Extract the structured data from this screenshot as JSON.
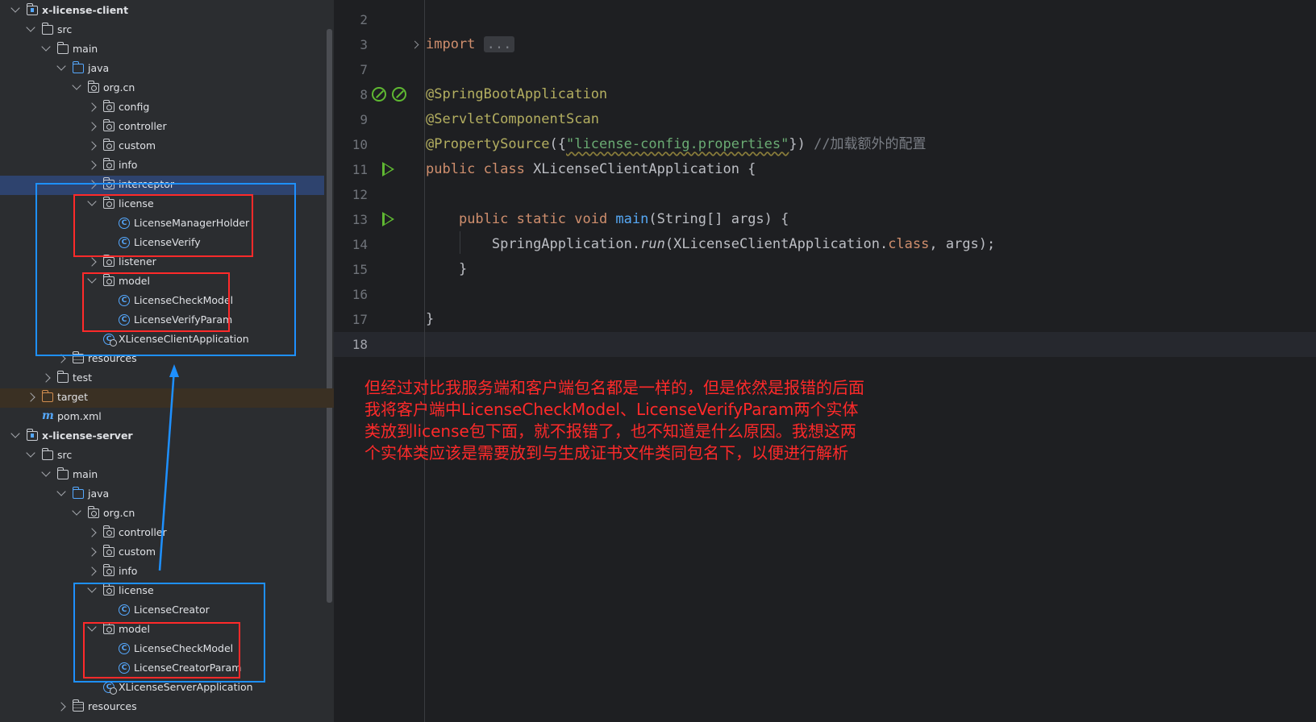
{
  "tree": [
    {
      "label": "x-license-client",
      "icon": "module",
      "expanded": true,
      "bold": true,
      "depth": 0
    },
    {
      "label": "src",
      "icon": "folder",
      "expanded": true,
      "depth": 1
    },
    {
      "label": "main",
      "icon": "folder",
      "expanded": true,
      "depth": 2
    },
    {
      "label": "java",
      "icon": "source-folder",
      "expanded": true,
      "depth": 3
    },
    {
      "label": "org.cn",
      "icon": "package",
      "expanded": true,
      "depth": 4
    },
    {
      "label": "config",
      "icon": "package",
      "expanded": false,
      "depth": 5
    },
    {
      "label": "controller",
      "icon": "package",
      "expanded": false,
      "depth": 5
    },
    {
      "label": "custom",
      "icon": "package",
      "expanded": false,
      "depth": 5
    },
    {
      "label": "info",
      "icon": "package",
      "expanded": false,
      "depth": 5
    },
    {
      "label": "interceptor",
      "icon": "package",
      "expanded": false,
      "depth": 5,
      "selected": true
    },
    {
      "label": "license",
      "icon": "package",
      "expanded": true,
      "depth": 5
    },
    {
      "label": "LicenseManagerHolder",
      "icon": "class",
      "depth": 6
    },
    {
      "label": "LicenseVerify",
      "icon": "class",
      "depth": 6
    },
    {
      "label": "listener",
      "icon": "package",
      "expanded": false,
      "depth": 5
    },
    {
      "label": "model",
      "icon": "package",
      "expanded": true,
      "depth": 5
    },
    {
      "label": "LicenseCheckModel",
      "icon": "class",
      "depth": 6
    },
    {
      "label": "LicenseVerifyParam",
      "icon": "class",
      "depth": 6
    },
    {
      "label": "XLicenseClientApplication",
      "icon": "spring-app",
      "depth": 5
    },
    {
      "label": "resources",
      "icon": "resources",
      "expanded": false,
      "depth": 3
    },
    {
      "label": "test",
      "icon": "folder",
      "expanded": false,
      "depth": 2
    },
    {
      "label": "target",
      "icon": "excluded-folder",
      "expanded": false,
      "depth": 1,
      "excluded": true
    },
    {
      "label": "pom.xml",
      "icon": "maven",
      "depth": 1
    },
    {
      "label": "x-license-server",
      "icon": "module",
      "expanded": true,
      "bold": true,
      "depth": 0
    },
    {
      "label": "src",
      "icon": "folder",
      "expanded": true,
      "depth": 1
    },
    {
      "label": "main",
      "icon": "folder",
      "expanded": true,
      "depth": 2
    },
    {
      "label": "java",
      "icon": "source-folder",
      "expanded": true,
      "depth": 3
    },
    {
      "label": "org.cn",
      "icon": "package",
      "expanded": true,
      "depth": 4
    },
    {
      "label": "controller",
      "icon": "package",
      "expanded": false,
      "depth": 5
    },
    {
      "label": "custom",
      "icon": "package",
      "expanded": false,
      "depth": 5
    },
    {
      "label": "info",
      "icon": "package",
      "expanded": false,
      "depth": 5
    },
    {
      "label": "license",
      "icon": "package",
      "expanded": true,
      "depth": 5
    },
    {
      "label": "LicenseCreator",
      "icon": "class",
      "depth": 6
    },
    {
      "label": "model",
      "icon": "package",
      "expanded": true,
      "depth": 5
    },
    {
      "label": "LicenseCheckModel",
      "icon": "class",
      "depth": 6
    },
    {
      "label": "LicenseCreatorParam",
      "icon": "class",
      "depth": 6
    },
    {
      "label": "XLicenseServerApplication",
      "icon": "spring-app",
      "depth": 5
    },
    {
      "label": "resources",
      "icon": "resources",
      "expanded": false,
      "depth": 3
    }
  ],
  "editor": {
    "line_numbers": [
      "2",
      "3",
      "7",
      "8",
      "9",
      "10",
      "11",
      "12",
      "13",
      "14",
      "15",
      "16",
      "17",
      "18"
    ],
    "current_line": "18",
    "code": {
      "l3_import": "import",
      "l3_fold": "...",
      "l8": "@SpringBootApplication",
      "l9": "@ServletComponentScan",
      "l10_ann": "@PropertySource",
      "l10_open": "({",
      "l10_str": "\"license-config.properties\"",
      "l10_close": "}) ",
      "l10_cmt": "//加载额外的配置",
      "l11_kw": "public class ",
      "l11_name": "XLicenseClientApplication {",
      "l13_kw": "public static void ",
      "l13_fn": "main",
      "l13_rest": "(String[] args) {",
      "l14_a": "SpringApplication.",
      "l14_run": "run",
      "l14_b": "(XLicenseClientApplication.",
      "l14_class": "class",
      "l14_c": ", args);",
      "l15": "}",
      "l17": "}"
    }
  },
  "annotation": {
    "note": "但经过对比我服务端和客户端包名都是一样的，但是依然是报错的后面我将客户端中LicenseCheckModel、LicenseVerifyParam两个实体类放到license包下面，就不报错了，也不知道是什么原因。我想这两个实体类应该是需要放到与生成证书文件类同包名下，以便进行解析",
    "colors": {
      "red": "#ff2a2a",
      "blue": "#1e90ff"
    }
  }
}
